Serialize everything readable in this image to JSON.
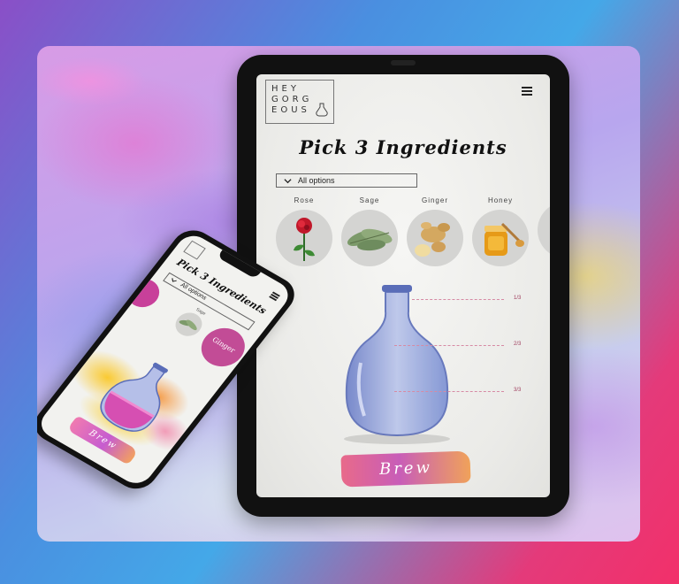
{
  "tablet": {
    "logo_lines": [
      "HEY",
      "GORG",
      "EOUS"
    ],
    "title": "Pick 3 Ingredients",
    "select_value": "All options",
    "ingredients": [
      {
        "label": "Rose",
        "icon": "rose-icon"
      },
      {
        "label": "Sage",
        "icon": "sage-icon"
      },
      {
        "label": "Ginger",
        "icon": "ginger-icon"
      },
      {
        "label": "Honey",
        "icon": "honey-icon"
      }
    ],
    "levels": [
      "1/3",
      "2/3",
      "3/3"
    ],
    "brew_label": "Brew"
  },
  "phone": {
    "title": "Pick 3 Ingredients",
    "select_value": "All options",
    "sage_label": "Sage",
    "ginger_label": "Ginger",
    "brew_label": "Brew"
  },
  "colors": {
    "brew_gradient_start": "#e86a8a",
    "brew_gradient_mid": "#c85db8",
    "brew_gradient_end": "#f0a25a",
    "jar_glass": "#7d8fd0",
    "phone_potion": "#d64fb2"
  }
}
